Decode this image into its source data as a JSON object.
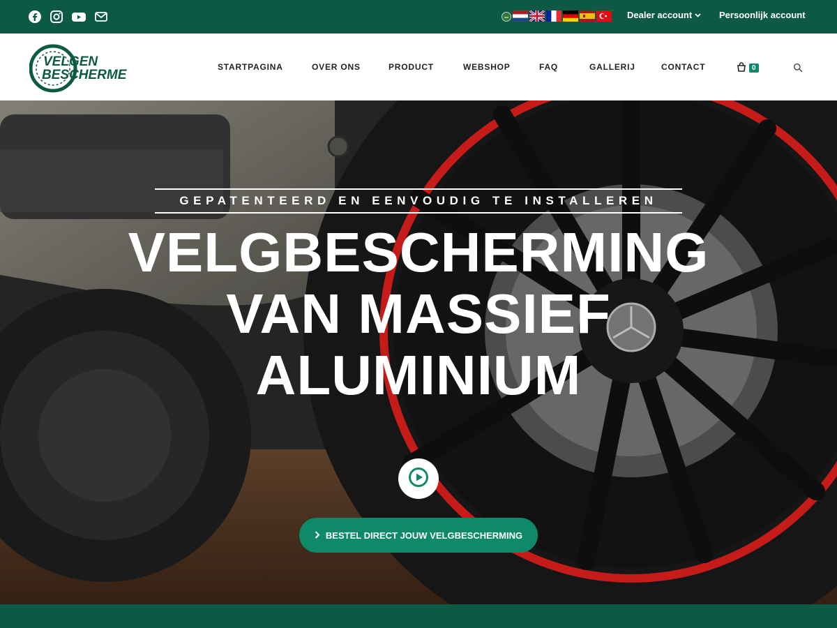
{
  "topbar": {
    "social_icons": [
      "facebook-icon",
      "instagram-icon",
      "youtube-icon",
      "email-icon"
    ],
    "flags": [
      "arabic-flag",
      "netherlands-flag",
      "uk-flag",
      "france-flag",
      "germany-flag",
      "spain-flag",
      "turkey-flag"
    ],
    "dealer_label": "Dealer account",
    "personal_label": "Persoonlijk account"
  },
  "header": {
    "logo_lines": [
      "VELGEN",
      "BESCHERMER"
    ],
    "nav": [
      "STARTPAGINA",
      "OVER ONS",
      "PRODUCT",
      "WEBSHOP",
      "FAQ",
      "GALLERIJ",
      "CONTACT"
    ],
    "cart_count": "0"
  },
  "hero": {
    "eyebrow": "GEPATENTEERD EN EENVOUDIG TE INSTALLEREN",
    "headline_lines": [
      "VELGBESCHERMING",
      "VAN MASSIEF",
      "ALUMINIUM"
    ],
    "cta_label": "BESTEL DIRECT JOUW VELGBESCHERMING"
  },
  "colors": {
    "brand_green": "#0d5a44",
    "accent_green": "#0e8a6a"
  }
}
